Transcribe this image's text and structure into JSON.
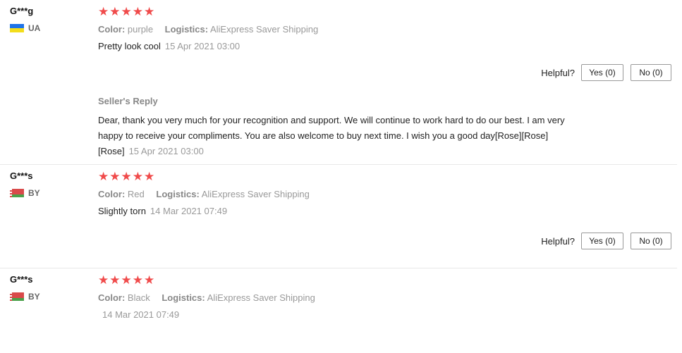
{
  "reviews": [
    {
      "user": "G***g",
      "country": "UA",
      "flag": "flag-ua-icon",
      "rating": 5,
      "stars": "★★★★★",
      "color_label": "Color:",
      "color_value": "purple",
      "logistics_label": "Logistics:",
      "logistics_value": "AliExpress Saver Shipping",
      "text": "Pretty look cool",
      "date": "15 Apr 2021 03:00",
      "helpful_label": "Helpful?",
      "yes_label": "Yes (0)",
      "no_label": "No (0)",
      "seller_reply": {
        "title": "Seller's Reply",
        "text": "Dear, thank you very much for your recognition and support. We will continue to work hard to do our best. I am very happy to receive your compliments. You are also welcome to buy next time. I wish you a good day[Rose][Rose][Rose]",
        "date": "15 Apr 2021 03:00"
      }
    },
    {
      "user": "G***s",
      "country": "BY",
      "flag": "flag-by-icon",
      "rating": 5,
      "stars": "★★★★★",
      "color_label": "Color:",
      "color_value": "Red",
      "logistics_label": "Logistics:",
      "logistics_value": "AliExpress Saver Shipping",
      "text": "Slightly torn",
      "date": "14 Mar 2021 07:49",
      "helpful_label": "Helpful?",
      "yes_label": "Yes (0)",
      "no_label": "No (0)"
    },
    {
      "user": "G***s",
      "country": "BY",
      "flag": "flag-by-icon",
      "rating": 5,
      "stars": "★★★★★",
      "color_label": "Color:",
      "color_value": "Black",
      "logistics_label": "Logistics:",
      "logistics_value": "AliExpress Saver Shipping",
      "text": "",
      "date": "14 Mar 2021 07:49"
    }
  ],
  "colors": {
    "star": "#f04b4b",
    "muted_text": "#999999",
    "divider": "#e8e8e8"
  }
}
